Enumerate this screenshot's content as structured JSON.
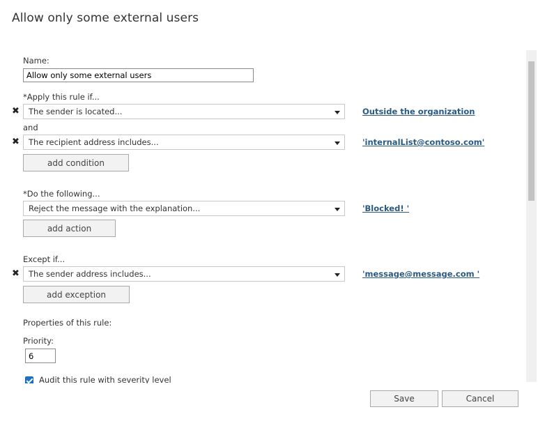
{
  "dialog": {
    "title": "Allow only some external users"
  },
  "name": {
    "label": "Name:",
    "value": "Allow only some external users"
  },
  "conditions": {
    "label": "*Apply this rule if...",
    "and_label": "and",
    "items": [
      {
        "selected": "The sender is located...",
        "value": "Outside the organization"
      },
      {
        "selected": "The recipient address includes...",
        "value": "'internalList@contoso.com'"
      }
    ],
    "add_label": "add condition"
  },
  "actions": {
    "label": "*Do the following...",
    "items": [
      {
        "selected": "Reject the message with the explanation...",
        "value": "'Blocked! '"
      }
    ],
    "add_label": "add action"
  },
  "exceptions": {
    "label": "Except if...",
    "items": [
      {
        "selected": "The sender address includes...",
        "value": "'message@message.com '"
      }
    ],
    "add_label": "add exception"
  },
  "properties": {
    "label": "Properties of this rule:",
    "priority_label": "Priority:",
    "priority_value": "6",
    "audit_label": "Audit this rule with severity level",
    "audit_checked": true
  },
  "footer": {
    "save_label": "Save",
    "cancel_label": "Cancel"
  },
  "icons": {
    "remove": "close-icon",
    "dropdown": "chevron-down-icon",
    "checkbox": "checkmark-icon"
  },
  "colors": {
    "link": "#2a5a83",
    "checkbox": "#1a73c8",
    "text": "#333333"
  }
}
